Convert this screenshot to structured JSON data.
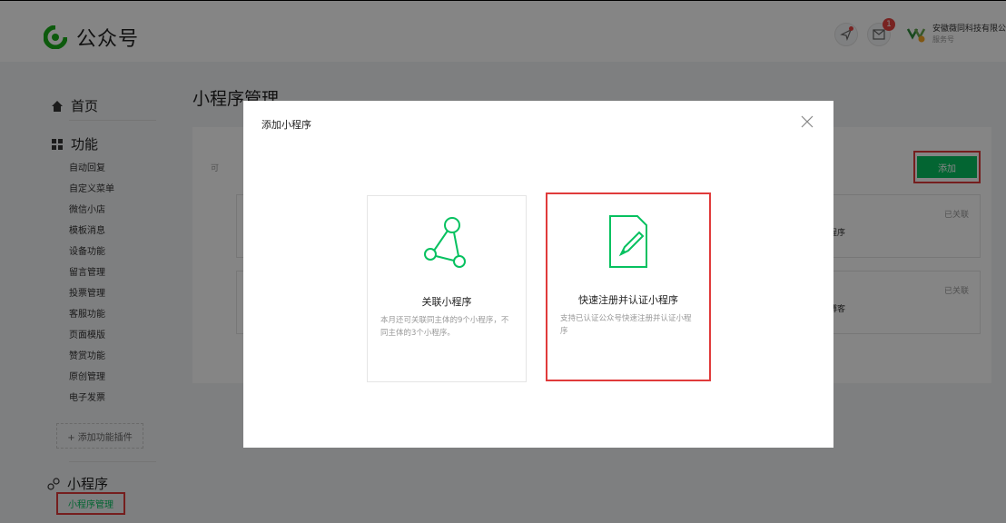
{
  "header": {
    "app_title": "公众号",
    "account_name": "安徽薇同科技有限公",
    "account_type": "服务号",
    "message_count": "1",
    "icons": [
      "notification-icon",
      "mail-icon",
      "account-logo-icon"
    ]
  },
  "sidebar": {
    "home_label": "首页",
    "features_label": "功能",
    "feature_items": [
      "自动回复",
      "自定义菜单",
      "微信小店",
      "模板消息",
      "设备功能",
      "留言管理",
      "投票管理",
      "客服功能",
      "页面模版",
      "赞赏功能",
      "原创管理",
      "电子发票"
    ],
    "add_plugin_label": "+ 添加功能插件",
    "miniprogram_label": "小程序",
    "miniprogram_manage_label": "小程序管理"
  },
  "main": {
    "page_title": "小程序管理",
    "hint_prefix": "可",
    "add_button_label": "添加",
    "list": [
      {
        "name_fragment": "程序",
        "status": "已关联"
      },
      {
        "name_fragment": "博客",
        "status": "已关联"
      }
    ]
  },
  "modal": {
    "title": "添加小程序",
    "options": [
      {
        "title": "关联小程序",
        "description": "本月还可关联同主体的9个小程序，不同主体的3个小程序。"
      },
      {
        "title": "快速注册并认证小程序",
        "description": "支持已认证公众号快速注册并认证小程序"
      }
    ]
  },
  "colors": {
    "accent": "#07c160",
    "highlight": "#e03b3b",
    "badge": "#e64340"
  }
}
